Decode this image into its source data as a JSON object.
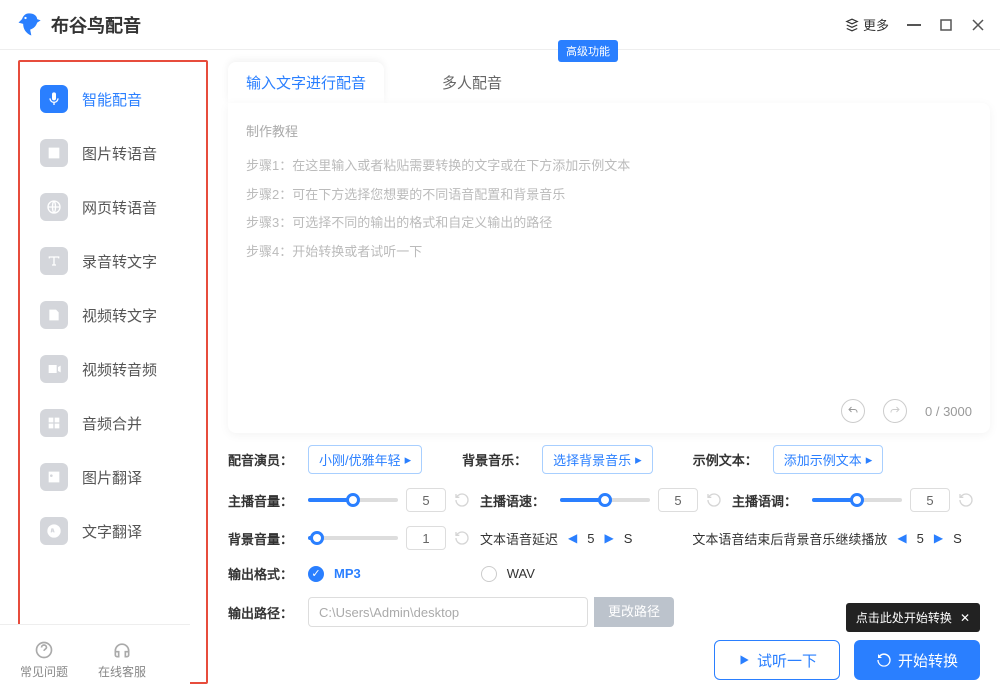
{
  "app": {
    "title": "布谷鸟配音",
    "more": "更多"
  },
  "sidebar": {
    "items": [
      {
        "label": "智能配音"
      },
      {
        "label": "图片转语音"
      },
      {
        "label": "网页转语音"
      },
      {
        "label": "录音转文字"
      },
      {
        "label": "视频转文字"
      },
      {
        "label": "视频转音频"
      },
      {
        "label": "音频合并"
      },
      {
        "label": "图片翻译"
      },
      {
        "label": "文字翻译"
      }
    ]
  },
  "bottom": {
    "faq": "常见问题",
    "support": "在线客服"
  },
  "tabs": {
    "t1": "输入文字进行配音",
    "t2": "多人配音",
    "badge": "高级功能"
  },
  "editor": {
    "header": "制作教程",
    "lines": [
      "步骤1：在这里输入或者粘贴需要转换的文字或在下方添加示例文本",
      "步骤2：可在下方选择您想要的不同语音配置和背景音乐",
      "步骤3：可选择不同的输出的格式和自定义输出的路径",
      "步骤4：开始转换或者试听一下"
    ],
    "counter": "0 / 3000"
  },
  "controls": {
    "actor_label": "配音演员：",
    "actor_value": "小刚/优雅年轻",
    "bgm_label": "背景音乐：",
    "bgm_value": "选择背景音乐",
    "sample_label": "示例文本：",
    "sample_value": "添加示例文本",
    "vol_label": "主播音量：",
    "vol_value": "5",
    "speed_label": "主播语速：",
    "speed_value": "5",
    "tone_label": "主播语调：",
    "tone_value": "5",
    "bgvol_label": "背景音量：",
    "bgvol_value": "1",
    "delay_label": "文本语音延迟",
    "delay_value": "5",
    "delay_unit": "S",
    "continue_label": "文本语音结束后背景音乐继续播放",
    "continue_value": "5",
    "continue_unit": "S",
    "format_label": "输出格式：",
    "format_mp3": "MP3",
    "format_wav": "WAV",
    "path_label": "输出路径：",
    "path_value": "C:\\Users\\Admin\\desktop",
    "path_btn": "更改路径"
  },
  "actions": {
    "preview": "试听一下",
    "convert": "开始转换",
    "tooltip": "点击此处开始转换"
  }
}
